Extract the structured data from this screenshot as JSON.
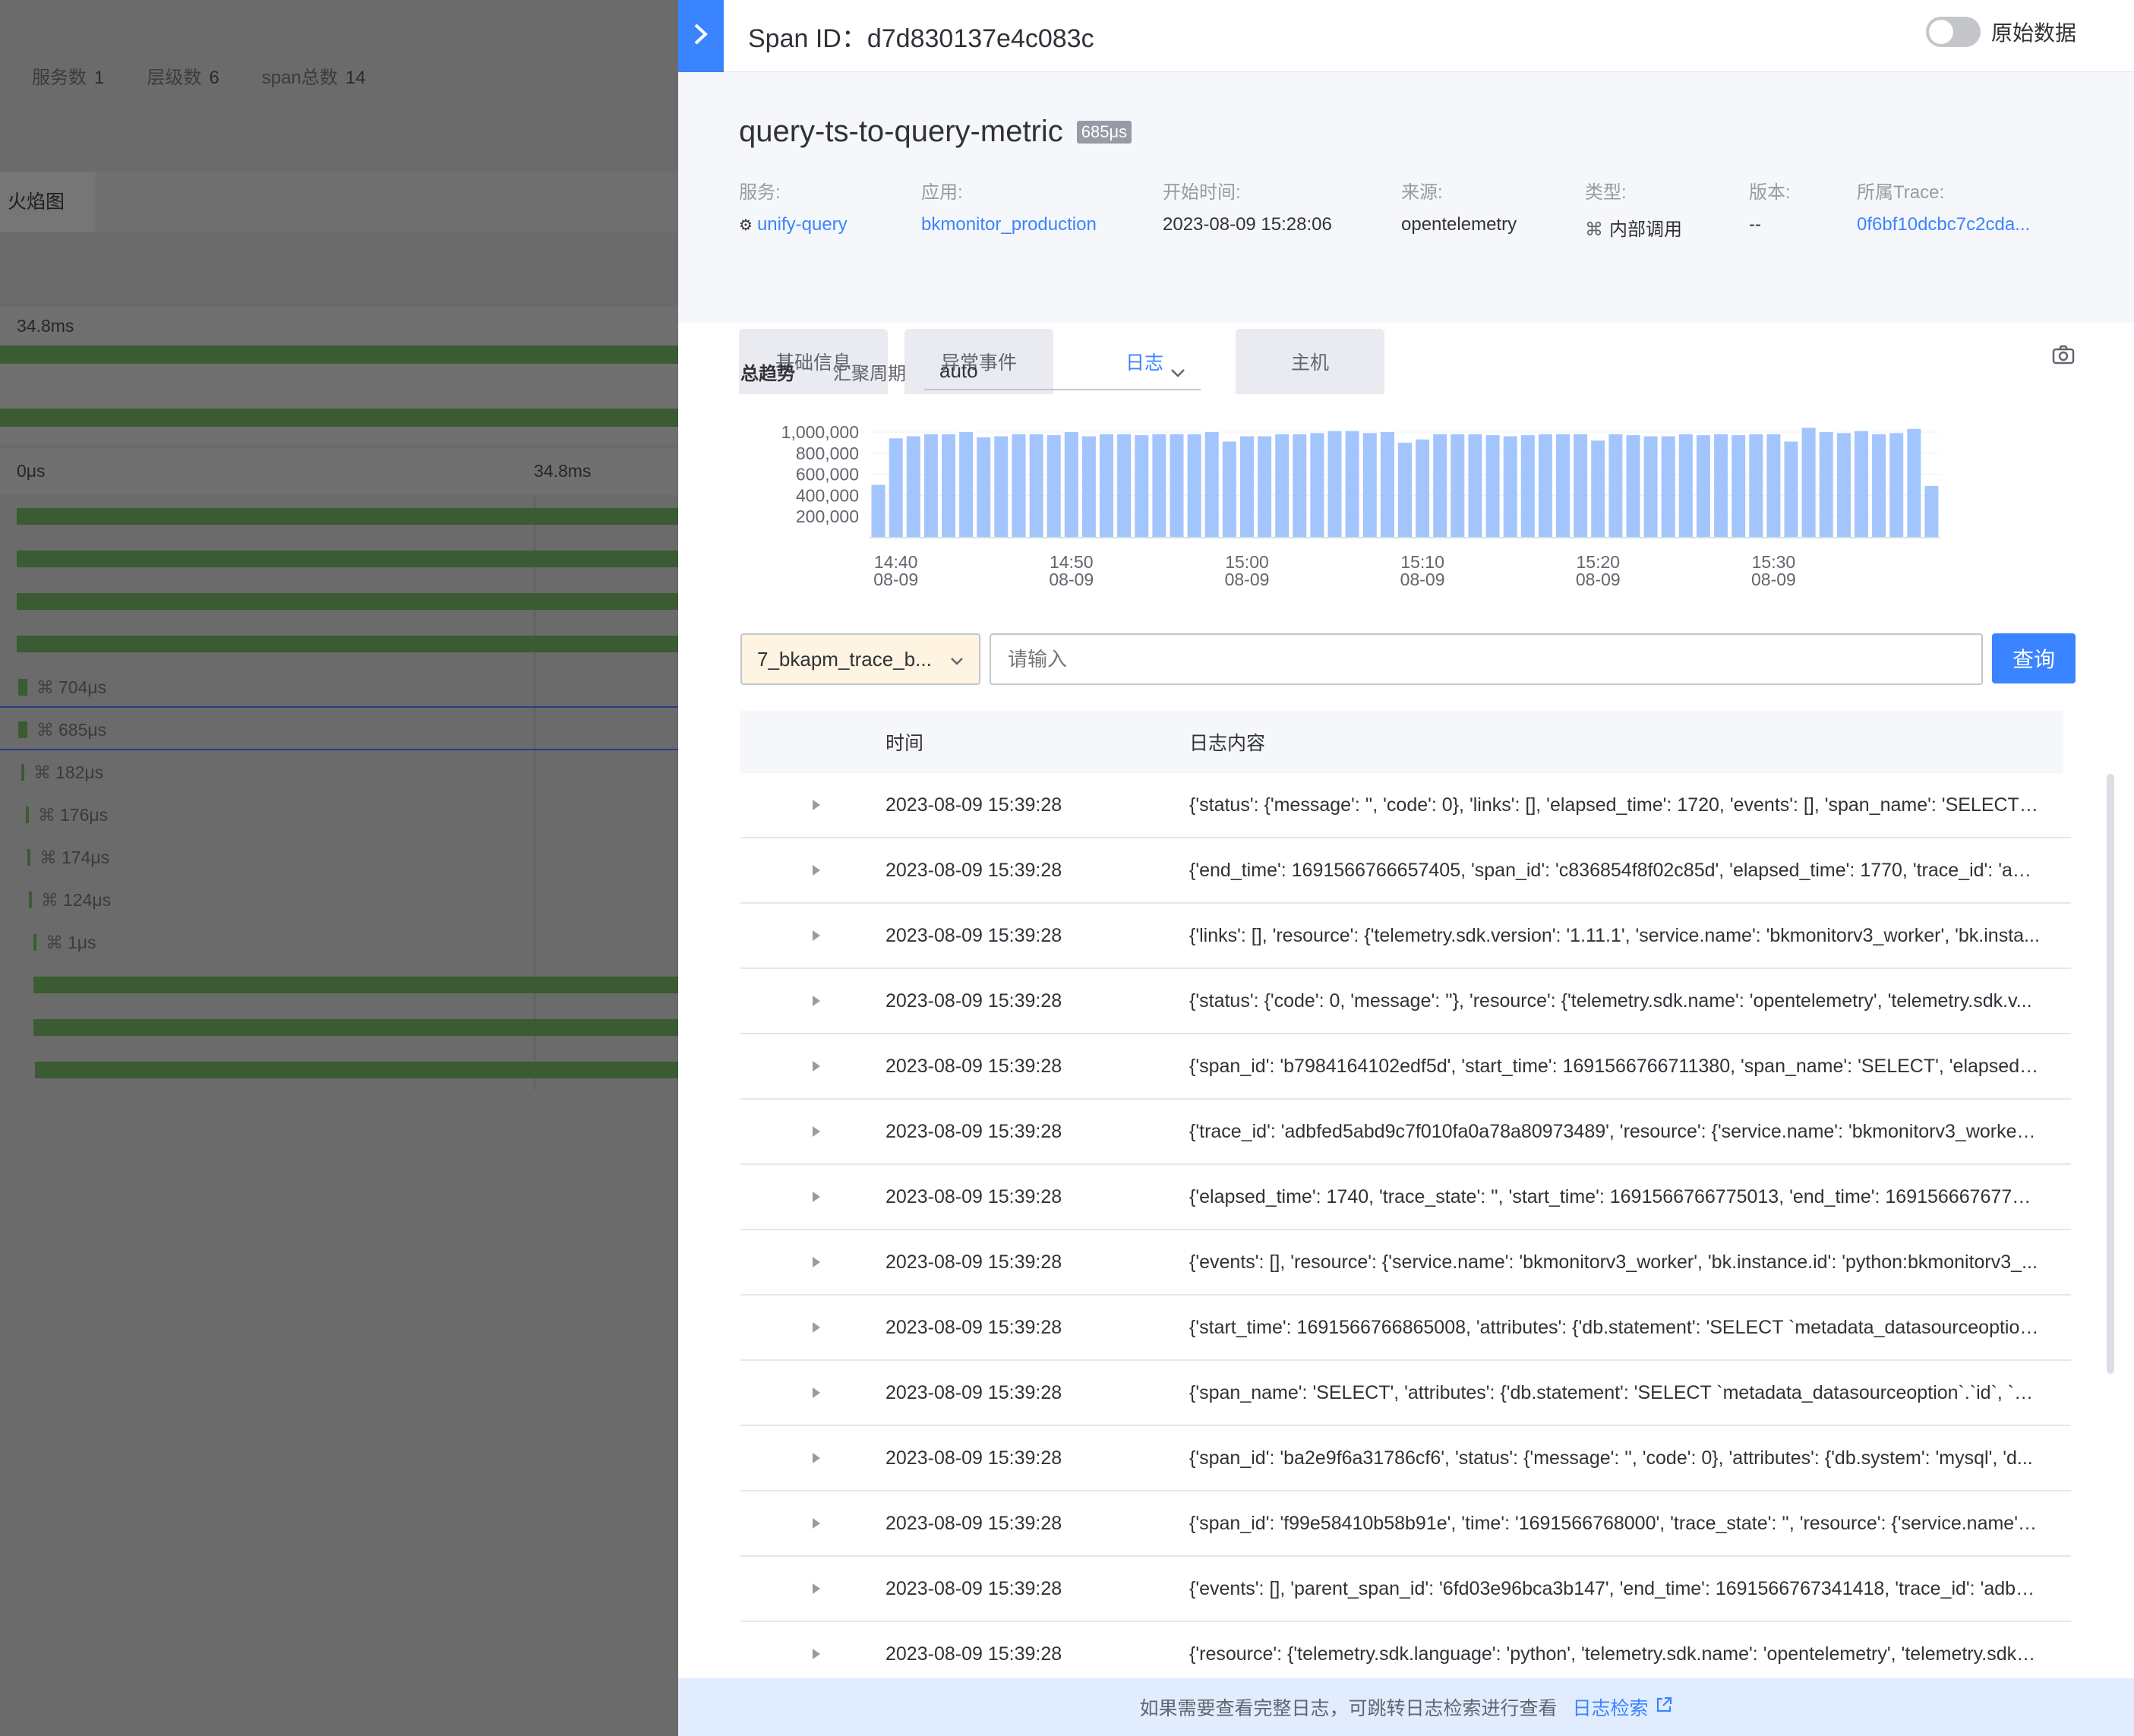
{
  "background": {
    "stats": [
      {
        "label": "服务数",
        "value": "1"
      },
      {
        "label": "层级数",
        "value": "6"
      },
      {
        "label": "span总数",
        "value": "14"
      }
    ],
    "tab": "火焰图",
    "timeline_top": "34.8ms",
    "axis_start": "0μs",
    "axis_mid": "34.8ms",
    "durations": [
      "704μs",
      "685μs",
      "182μs",
      "176μs",
      "174μs",
      "124μs",
      "1μs"
    ]
  },
  "panel": {
    "span_id_label": "Span ID：",
    "span_id": "d7d830137e4c083c",
    "raw_toggle_label": "原始数据",
    "operation": "query-ts-to-query-metric",
    "duration_badge": "685μs",
    "meta": [
      {
        "key": "服务:",
        "value": "unify-query",
        "icon": "service-icon",
        "link": true
      },
      {
        "key": "应用:",
        "value": "bkmonitor_production",
        "link": true
      },
      {
        "key": "开始时间:",
        "value": "2023-08-09 15:28:06",
        "link": false
      },
      {
        "key": "来源:",
        "value": "opentelemetry",
        "link": false
      },
      {
        "key": "类型:",
        "value": "内部调用",
        "icon": "internal-call-icon",
        "link": false
      },
      {
        "key": "版本:",
        "value": "--",
        "link": false
      },
      {
        "key": "所属Trace:",
        "value": "0f6bf10dcbc7c2cda...",
        "link": true
      }
    ],
    "tabs": [
      {
        "label": "基础信息",
        "active": false
      },
      {
        "label": "异常事件",
        "active": false
      },
      {
        "label": "日志",
        "active": true
      },
      {
        "label": "主机",
        "active": false
      }
    ],
    "trend_label": "总趋势",
    "period_label": "汇聚周期",
    "period_value": "auto",
    "index_select": "7_bkapm_trace_b...",
    "search_placeholder": "请输入",
    "query_button": "查询",
    "table_headers": {
      "time": "时间",
      "content": "日志内容"
    },
    "rows": [
      {
        "time": "2023-08-09 15:39:28",
        "content": "{'status': {'message': '', 'code': 0}, 'links': [], 'elapsed_time': 1720, 'events': [], 'span_name': 'SELECT',..."
      },
      {
        "time": "2023-08-09 15:39:28",
        "content": "{'end_time': 1691566766657405, 'span_id': 'c836854f8f02c85d', 'elapsed_time': 1770, 'trace_id': 'adb..."
      },
      {
        "time": "2023-08-09 15:39:28",
        "content": "{'links': [], 'resource': {'telemetry.sdk.version': '1.11.1', 'service.name': 'bkmonitorv3_worker', 'bk.insta..."
      },
      {
        "time": "2023-08-09 15:39:28",
        "content": "{'status': {'code': 0, 'message': ''}, 'resource': {'telemetry.sdk.name': 'opentelemetry', 'telemetry.sdk.v..."
      },
      {
        "time": "2023-08-09 15:39:28",
        "content": "{'span_id': 'b7984164102edf5d', 'start_time': 1691566766711380, 'span_name': 'SELECT', 'elapsed_ti..."
      },
      {
        "time": "2023-08-09 15:39:28",
        "content": "{'trace_id': 'adbfed5abd9c7f010fa0a78a80973489', 'resource': {'service.name': 'bkmonitorv3_worker',..."
      },
      {
        "time": "2023-08-09 15:39:28",
        "content": "{'elapsed_time': 1740, 'trace_state': '', 'start_time': 1691566766775013, 'end_time': 16915666767767..."
      },
      {
        "time": "2023-08-09 15:39:28",
        "content": "{'events': [], 'resource': {'service.name': 'bkmonitorv3_worker', 'bk.instance.id': 'python:bkmonitorv3_..."
      },
      {
        "time": "2023-08-09 15:39:28",
        "content": "{'start_time': 1691566766865008, 'attributes': {'db.statement': 'SELECT `metadata_datasourceoption`...."
      },
      {
        "time": "2023-08-09 15:39:28",
        "content": "{'span_name': 'SELECT', 'attributes': {'db.statement': 'SELECT `metadata_datasourceoption`.`id`, `met..."
      },
      {
        "time": "2023-08-09 15:39:28",
        "content": "{'span_id': 'ba2e9f6a31786cf6', 'status': {'message': '', 'code': 0}, 'attributes': {'db.system': 'mysql', 'd..."
      },
      {
        "time": "2023-08-09 15:39:28",
        "content": "{'span_id': 'f99e58410b58b91e', 'time': '1691566768000', 'trace_state': '', 'resource': {'service.name': ..."
      },
      {
        "time": "2023-08-09 15:39:28",
        "content": "{'events': [], 'parent_span_id': '6fd03e96bca3b147', 'end_time': 1691566767341418, 'trace_id': 'adbfe..."
      },
      {
        "time": "2023-08-09 15:39:28",
        "content": "{'resource': {'telemetry.sdk.language': 'python', 'telemetry.sdk.name': 'opentelemetry', 'telemetry.sdk.v..."
      }
    ],
    "footer_text": "如果需要查看完整日志，可跳转日志检索进行查看",
    "footer_link": "日志检索"
  },
  "chart_data": {
    "type": "bar",
    "color": "#a3c5fd",
    "ylim": [
      0,
      1050000
    ],
    "ytick_labels": [
      "1,000,000",
      "800,000",
      "600,000",
      "400,000",
      "200,000"
    ],
    "yticks": [
      1000000,
      800000,
      600000,
      400000,
      200000
    ],
    "xtick_labels": [
      {
        "time": "14:40",
        "date": "08-09",
        "index": 1
      },
      {
        "time": "14:50",
        "date": "08-09",
        "index": 11
      },
      {
        "time": "15:00",
        "date": "08-09",
        "index": 21
      },
      {
        "time": "15:10",
        "date": "08-09",
        "index": 31
      },
      {
        "time": "15:20",
        "date": "08-09",
        "index": 41
      },
      {
        "time": "15:30",
        "date": "08-09",
        "index": 51
      }
    ],
    "values": [
      500000,
      940000,
      960000,
      980000,
      980000,
      1000000,
      950000,
      960000,
      980000,
      980000,
      970000,
      1000000,
      960000,
      980000,
      980000,
      970000,
      980000,
      980000,
      980000,
      1000000,
      910000,
      960000,
      960000,
      980000,
      980000,
      990000,
      1010000,
      1010000,
      990000,
      1000000,
      900000,
      930000,
      980000,
      980000,
      980000,
      970000,
      960000,
      970000,
      980000,
      980000,
      980000,
      920000,
      980000,
      970000,
      960000,
      960000,
      980000,
      970000,
      980000,
      970000,
      980000,
      980000,
      910000,
      1040000,
      1000000,
      990000,
      1010000,
      980000,
      990000,
      1030000,
      490000
    ]
  }
}
